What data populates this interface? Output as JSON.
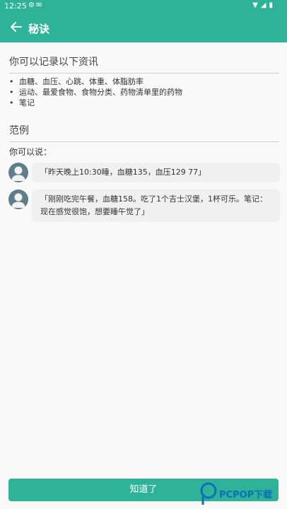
{
  "status_bar": {
    "time": "12:25"
  },
  "app_bar": {
    "title": "秘诀"
  },
  "record_section": {
    "heading": "你可以记录以下资讯",
    "items": [
      "血糖、血压、心跳、体重、体脂肪率",
      "运动、最爱食物、食物分类、药物清单里的药物",
      "笔记"
    ]
  },
  "example_section": {
    "heading": "范例",
    "intro": "你可以说：",
    "examples": [
      {
        "text": "「昨天晚上10:30睡，血糖135，血压129 77」"
      },
      {
        "text": "「刚刚吃完午餐，血糖158。吃了1个吉士汉堡，1杯可乐。笔记：现在感觉很饱，想要睡午觉了」"
      }
    ]
  },
  "actions": {
    "confirm_label": "知道了"
  },
  "watermark": {
    "text": "PCPOP下载"
  },
  "colors": {
    "primary": "#2eb398",
    "avatar": "#5f7d8a"
  }
}
